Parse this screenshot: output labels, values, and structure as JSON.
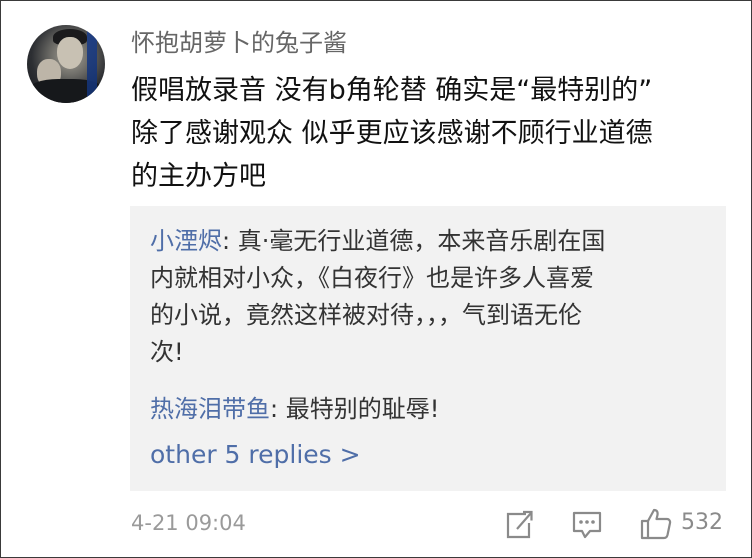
{
  "comment": {
    "username": "怀抱胡萝卜的兔子酱",
    "content_lines": [
      "假唱放录音 没有b角轮替 确实是“最特别的”",
      "除了感谢观众 似乎更应该感谢不顾行业道德",
      "的主办方吧"
    ],
    "replies": [
      {
        "name": "小湮烬",
        "separator": ": ",
        "lines": [
          "真·毫无行业道德，本来音乐剧在国",
          "内就相对小众，《白夜行》也是许多人喜爱",
          "的小说，竟然这样被对待，，，气到语无伦",
          "次!"
        ]
      },
      {
        "name": "热海泪带鱼",
        "separator": ": ",
        "lines": [
          "最特别的耻辱!"
        ]
      }
    ],
    "more_replies": "other 5 replies >",
    "timestamp": "4-21 09:04",
    "likes": "532"
  },
  "icons": {
    "avatar": "user-avatar-photo",
    "share": "share-icon",
    "comment": "comment-icon",
    "like": "thumbs-up-icon"
  },
  "colors": {
    "username": "#666666",
    "text": "#111111",
    "reply_name": "#4f6ea8",
    "reply_bg": "#f2f2f2",
    "meta": "#9a9a9a",
    "icon": "#8a8a8a"
  }
}
